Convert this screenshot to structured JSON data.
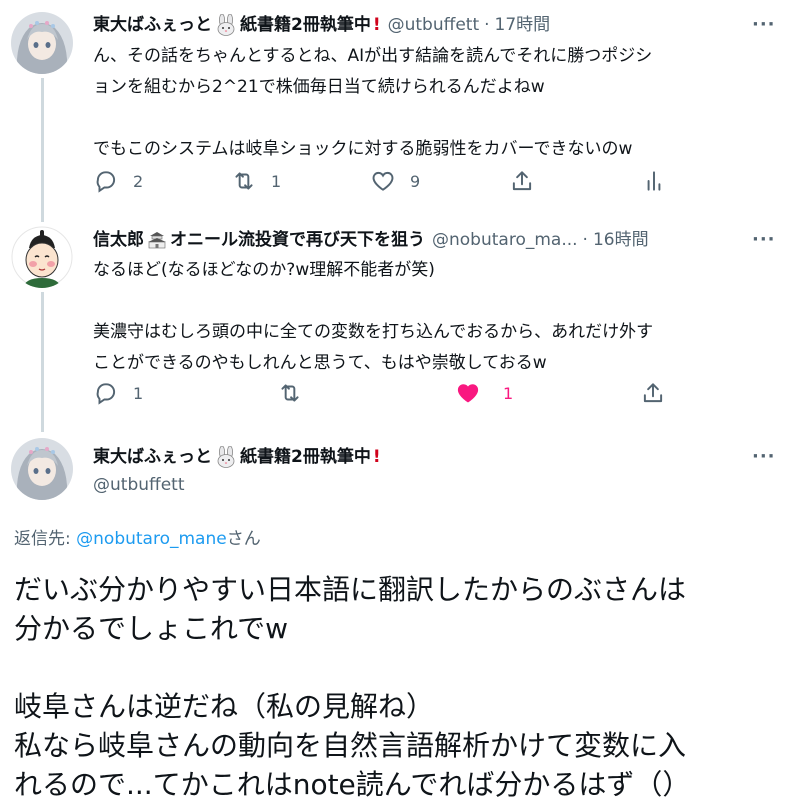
{
  "tweet1": {
    "name": "東大ばふぇっと",
    "name_suffix": "紙書籍2冊執筆中",
    "handle": "@utbuffett",
    "time": "17時間",
    "text": "ん、その話をちゃんとするとね、AIが出す結論を読んでそれに勝つポジシ\nョンを組むから2^21で株価毎日当て続けられるんだよねw\n\nでもこのシステムは岐阜ショックに対する脆弱性をカバーできないのw",
    "reply_count": "2",
    "retweet_count": "1",
    "like_count": "9"
  },
  "tweet2": {
    "name": "信太郎",
    "name_suffix": "オニール流投資で再び天下を狙う",
    "handle": "@nobutaro_ma...",
    "time": "16時間",
    "text": "なるほど(なるほどなのか?w理解不能者が笑)\n\n美濃守はむしろ頭の中に全ての変数を打ち込んでおるから、あれだけ外す\nことができるのやもしれんと思うて、もはや崇敬しておるw",
    "reply_count": "1",
    "like_count": "1"
  },
  "tweet3": {
    "name": "東大ばふぇっと",
    "name_suffix": "紙書籍2冊執筆中",
    "handle": "@utbuffett",
    "reply_to_label": "返信先:",
    "reply_to_handle": "@nobutaro_mane",
    "reply_to_suffix": "さん",
    "text": "だいぶ分かりやすい日本語に翻訳したからのぶさんは\n分かるでしょこれでw\n\n岐阜さんは逆だね（私の見解ね）\n私なら岐阜さんの動向を自然言語解析かけて変数に入\nれるので...てかこれはnote読んでれば分かるはず（）"
  },
  "more_label": "···",
  "separator": "·",
  "colors": {
    "like_active": "#f91880",
    "link": "#1d9bf0",
    "muted": "#536471",
    "thread_line": "#cfd9de"
  },
  "icons": [
    "reply-icon",
    "retweet-icon",
    "like-icon",
    "share-icon",
    "analytics-icon",
    "rabbit-emoji-icon",
    "castle-emoji-icon",
    "exclamation-icon",
    "more-icon"
  ]
}
